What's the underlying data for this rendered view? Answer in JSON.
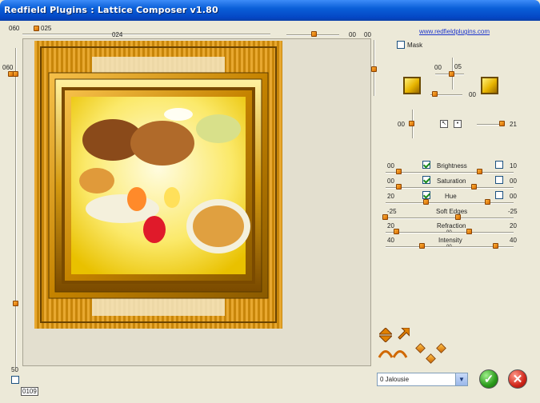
{
  "window": {
    "title": "Redfield Plugins : Lattice Composer v1.80"
  },
  "link": {
    "text": "www.redfieldplugins.com"
  },
  "top_slider": {
    "left_value": "060",
    "thumb_value": "025",
    "mid_value": "024"
  },
  "top_right_slider": {
    "value_a": "00",
    "value_b": "00"
  },
  "left_slider": {
    "top_value": "060",
    "bottom_value": "50"
  },
  "mask": {
    "label": "Mask",
    "checked": false
  },
  "offset_slider": {
    "top_value": "05",
    "left_value": "00",
    "right_value": "00"
  },
  "rotate_slider": {
    "left_value": "00",
    "right_value": "21"
  },
  "adjustments": [
    {
      "label": "Brightness",
      "left": "00",
      "right": "10",
      "left_checked": true,
      "right_checked": false
    },
    {
      "label": "Saturation",
      "left": "00",
      "right": "00",
      "left_checked": true,
      "right_checked": false
    },
    {
      "label": "Hue",
      "left": "20",
      "right": "00",
      "left_checked": true,
      "right_checked": false
    },
    {
      "label": "Soft Edges",
      "left": "-25",
      "right": "-25",
      "mid": ""
    },
    {
      "label": "Refraction",
      "left": "20",
      "right": "20",
      "mid": "00"
    },
    {
      "label": "Intensity",
      "left": "40",
      "right": "40",
      "mid": "00"
    }
  ],
  "preset": {
    "selected": "0 Jalousie"
  },
  "status": {
    "value": "0109"
  },
  "buttons": {
    "ok": "✓",
    "cancel": "✕"
  },
  "colors": {
    "accent": "#e07b00",
    "title_blue": "#0a5fd8",
    "ok_green": "#2a9a1a",
    "cancel_red": "#d0261a"
  },
  "preview": {
    "description_icon": "lattice-framed-image"
  }
}
